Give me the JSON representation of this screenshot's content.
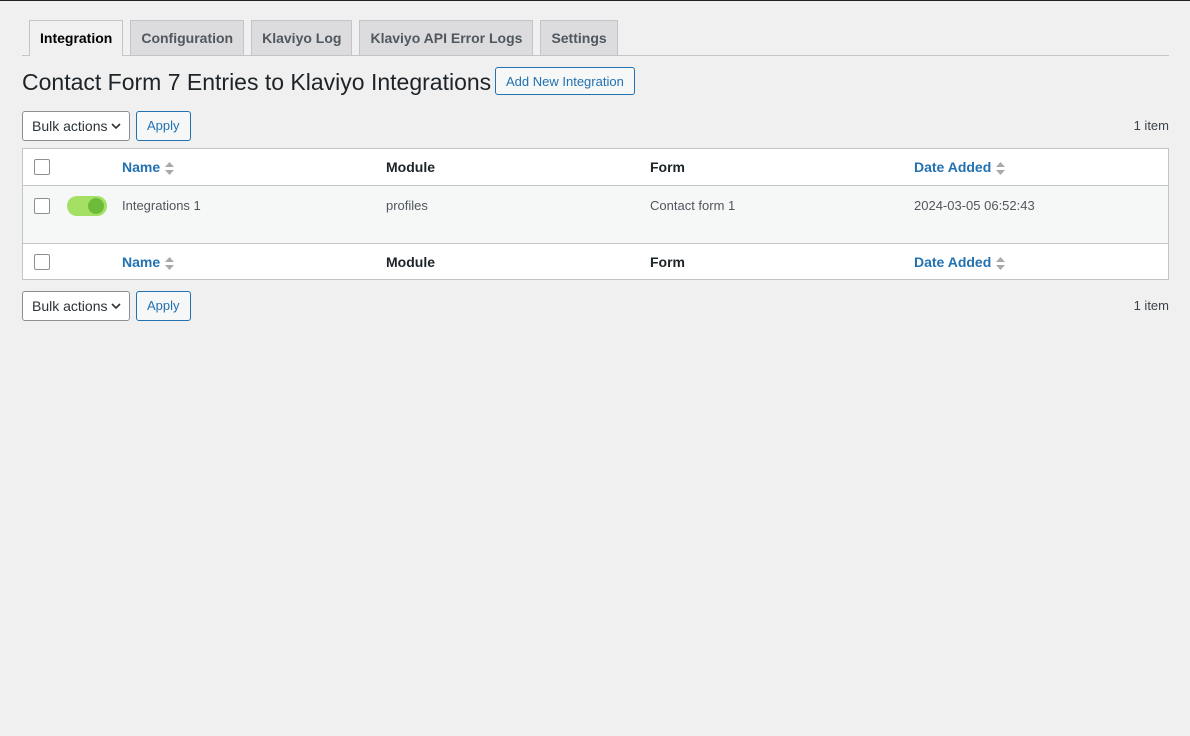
{
  "tabs": [
    {
      "label": "Integration",
      "active": true
    },
    {
      "label": "Configuration"
    },
    {
      "label": "Klaviyo Log"
    },
    {
      "label": "Klaviyo API Error Logs"
    },
    {
      "label": "Settings"
    }
  ],
  "page": {
    "title": "Contact Form 7 Entries to Klaviyo Integrations",
    "add_new_label": "Add New Integration"
  },
  "bulk": {
    "select_value": "Bulk actions",
    "apply_label": "Apply",
    "count": "1 item"
  },
  "table": {
    "columns": {
      "name": "Name",
      "module": "Module",
      "form": "Form",
      "date": "Date Added"
    },
    "rows": [
      {
        "name": "Integrations 1",
        "module": "profiles",
        "form": "Contact form 1",
        "date": "2024-03-05 06:52:43",
        "enabled": true
      }
    ]
  },
  "colors": {
    "link": "#2271b1",
    "toggle_on": "#a3e063"
  }
}
